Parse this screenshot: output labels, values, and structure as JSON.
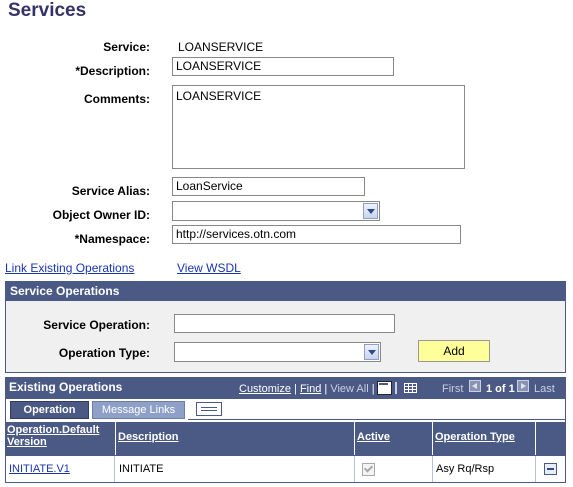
{
  "page": {
    "title": "Services"
  },
  "form": {
    "service_label": "Service:",
    "service_value": "LOANSERVICE",
    "description_label": "*Description:",
    "description_value": "LOANSERVICE",
    "comments_label": "Comments:",
    "comments_value": "LOANSERVICE",
    "alias_label": "Service Alias:",
    "alias_value": "LoanService",
    "owner_label": "Object Owner ID:",
    "owner_value": "",
    "namespace_label": "*Namespace:",
    "namespace_value": "http://services.otn.com"
  },
  "links": {
    "link_existing": "Link Existing Operations",
    "view_wsdl": "View WSDL"
  },
  "service_operations": {
    "header": "Service Operations",
    "operation_label": "Service Operation:",
    "operation_value": "",
    "type_label": "Operation Type:",
    "type_value": "",
    "add_label": "Add"
  },
  "existing_operations": {
    "header": "Existing Operations",
    "customize": "Customize",
    "find": "Find",
    "view_all": "View All",
    "sep": "|",
    "first": "First",
    "pager": "1 of 1",
    "last": "Last",
    "tabs": {
      "operation": "Operation",
      "message_links": "Message Links"
    },
    "columns": {
      "operation": "Operation.Default Version",
      "description": "Description",
      "active": "Active",
      "type": "Operation Type"
    },
    "rows": [
      {
        "operation": "INITIATE.V1",
        "description": "INITIATE",
        "active": true,
        "type": "Asy Rq/Rsp"
      }
    ]
  },
  "colors": {
    "header": "#4a5a85",
    "link": "#1a35b0",
    "title": "#333366",
    "button": "#ffff99"
  }
}
